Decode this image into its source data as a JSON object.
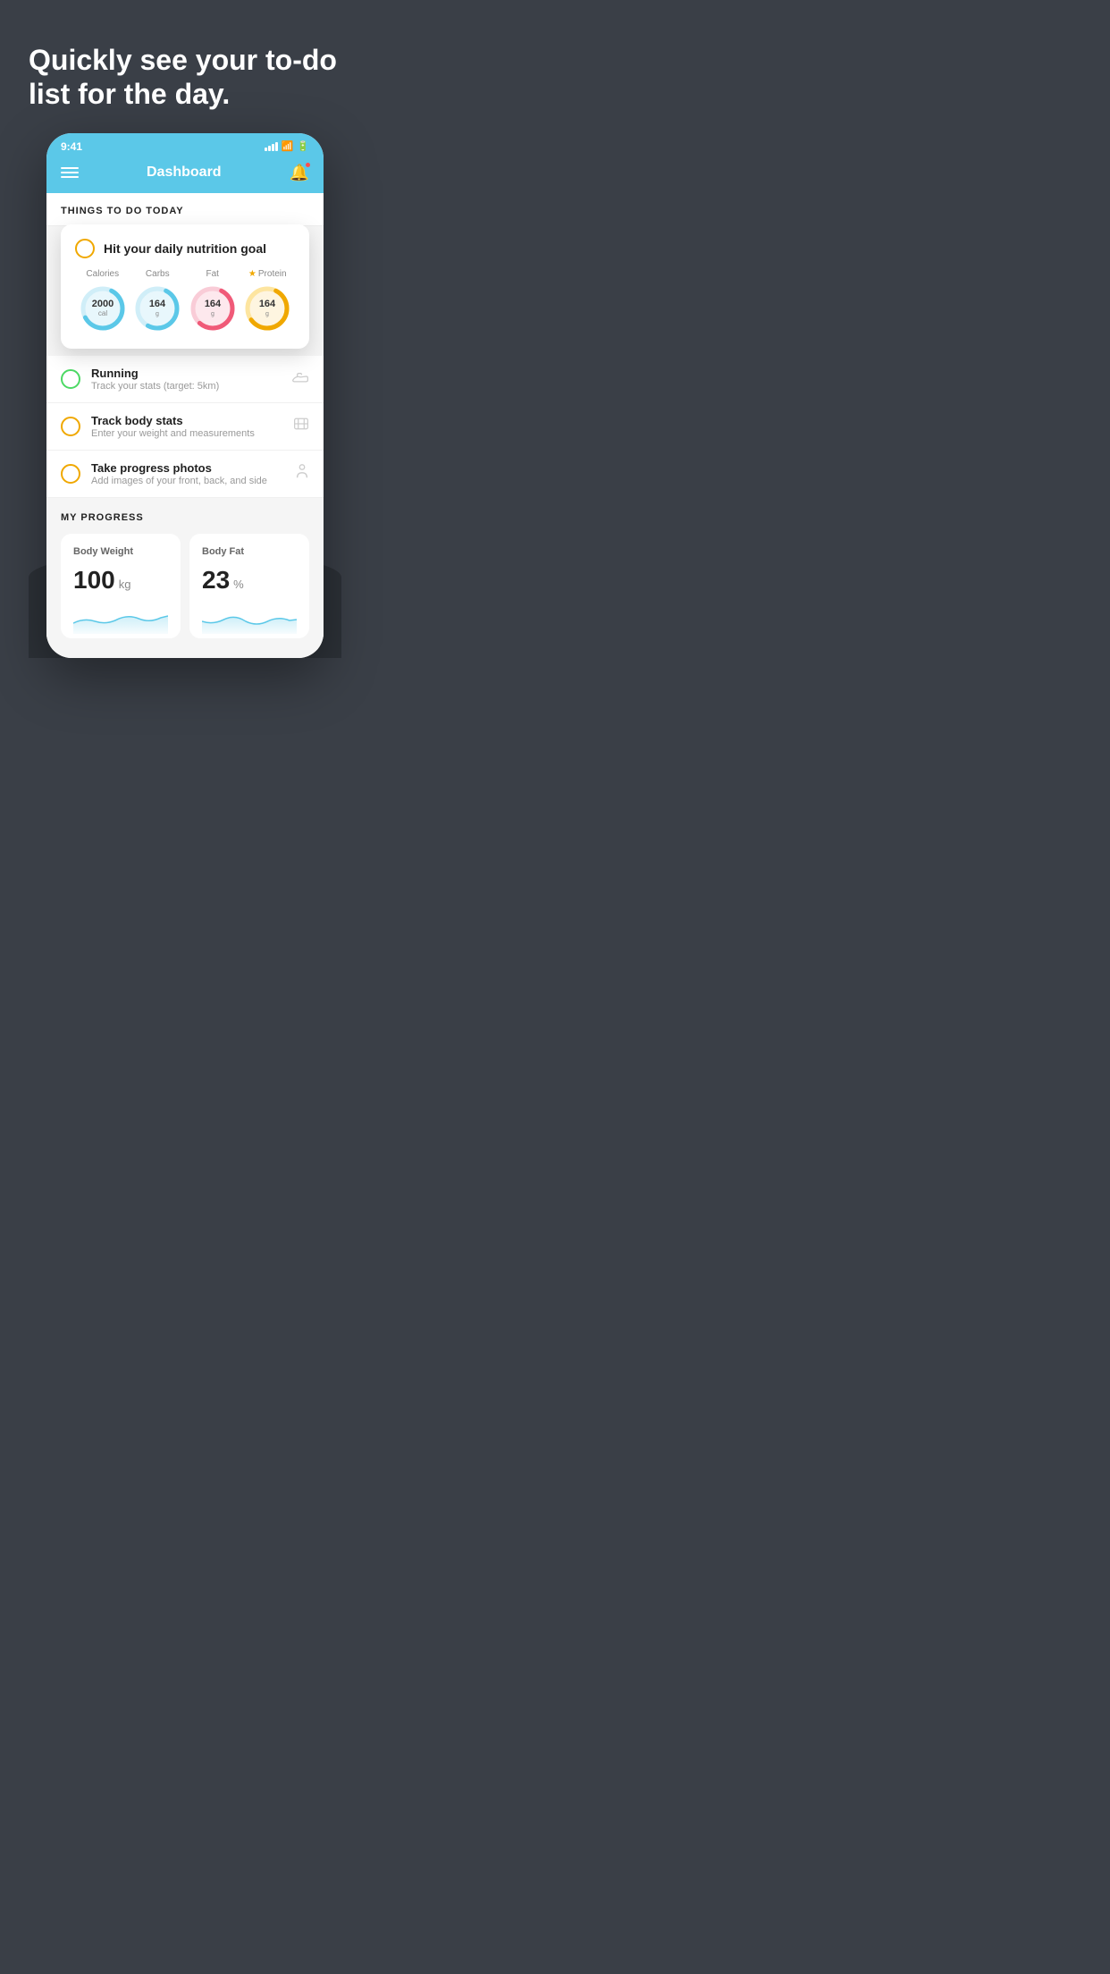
{
  "hero": {
    "title": "Quickly see your to-do list for the day."
  },
  "status_bar": {
    "time": "9:41"
  },
  "nav": {
    "title": "Dashboard"
  },
  "things_to_do": {
    "header": "THINGS TO DO TODAY"
  },
  "nutrition_card": {
    "title": "Hit your daily nutrition goal",
    "items": [
      {
        "label": "Calories",
        "value": "2000",
        "sub": "cal",
        "color": "#5bc8e8",
        "bg": "#e8f7fc",
        "star": false
      },
      {
        "label": "Carbs",
        "value": "164",
        "sub": "g",
        "color": "#5bc8e8",
        "bg": "#e8f7fc",
        "star": false
      },
      {
        "label": "Fat",
        "value": "164",
        "sub": "g",
        "color": "#f05a78",
        "bg": "#fde8ed",
        "star": false
      },
      {
        "label": "Protein",
        "value": "164",
        "sub": "g",
        "color": "#f0a800",
        "bg": "#fef5e0",
        "star": true
      }
    ]
  },
  "todo_items": [
    {
      "title": "Running",
      "subtitle": "Track your stats (target: 5km)",
      "circle_color": "green",
      "icon": "shoe"
    },
    {
      "title": "Track body stats",
      "subtitle": "Enter your weight and measurements",
      "circle_color": "yellow",
      "icon": "scale"
    },
    {
      "title": "Take progress photos",
      "subtitle": "Add images of your front, back, and side",
      "circle_color": "yellow",
      "icon": "person"
    }
  ],
  "progress": {
    "header": "MY PROGRESS",
    "cards": [
      {
        "title": "Body Weight",
        "value": "100",
        "unit": "kg"
      },
      {
        "title": "Body Fat",
        "value": "23",
        "unit": "%"
      }
    ]
  }
}
